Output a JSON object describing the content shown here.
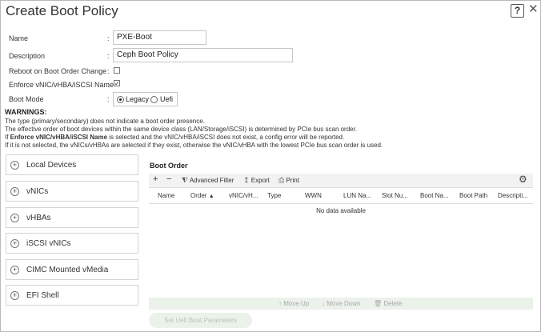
{
  "dialog": {
    "title": "Create Boot Policy",
    "help_label": "?",
    "close_label": "✕"
  },
  "form": {
    "name_label": "Name",
    "name_value": "PXE-Boot",
    "description_label": "Description",
    "description_value": "Ceph Boot Policy",
    "reboot_label": "Reboot on Boot Order Change",
    "reboot_checked": false,
    "enforce_label": "Enforce vNIC/vHBA/iSCSI Name",
    "enforce_checked": true,
    "boot_mode_label": "Boot Mode",
    "boot_mode_options": [
      "Legacy",
      "Uefi"
    ],
    "boot_mode_selected": "Legacy",
    "colon": ":"
  },
  "warnings": {
    "title": "WARNINGS:",
    "line1": "The type (primary/secondary) does not indicate a boot order presence.",
    "line2": "The effective order of boot devices within the same device class (LAN/Storage/iSCSI) is determined by PCIe bus scan order.",
    "line3_pre": "If ",
    "line3_bold": "Enforce vNIC/vHBA/iSCSI Name",
    "line3_post": " is selected and the vNIC/vHBA/iSCSI does not exist, a config error will be reported.",
    "line4": "If it is not selected, the vNICs/vHBAs are selected if they exist, otherwise the vNIC/vHBA with the lowest PCIe bus scan order is used."
  },
  "panels": [
    {
      "label": "Local Devices"
    },
    {
      "label": "vNICs"
    },
    {
      "label": "vHBAs"
    },
    {
      "label": "iSCSI vNICs"
    },
    {
      "label": "CIMC Mounted vMedia"
    },
    {
      "label": "EFI Shell"
    }
  ],
  "boot_order": {
    "title": "Boot Order",
    "toolbar": {
      "add": "+",
      "remove": "−",
      "advanced_filter": "Advanced Filter",
      "export": "Export",
      "print": "Print"
    },
    "columns": [
      "Name",
      "Order",
      "vNIC/vH...",
      "Type",
      "WWN",
      "LUN Na...",
      "Slot Nu...",
      "Boot Na...",
      "Boot Path",
      "Descripti..."
    ],
    "empty_text": "No data available",
    "actions": {
      "move_up": "Move Up",
      "move_down": "Move Down",
      "delete": "Delete"
    },
    "set_button": "Set Uefi Boot Parameters"
  }
}
